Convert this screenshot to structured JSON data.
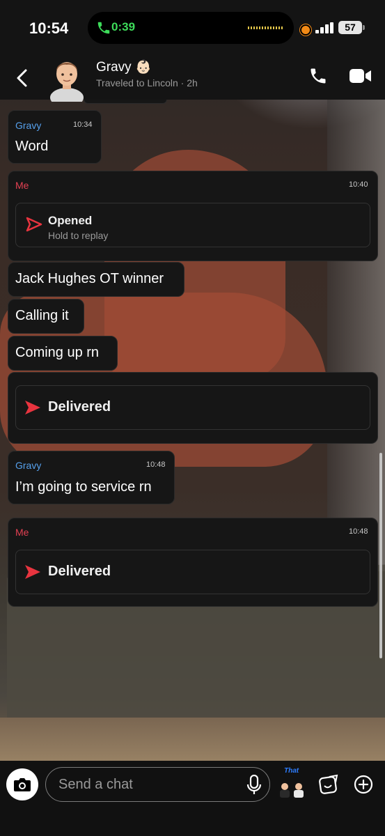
{
  "status_bar": {
    "time": "10:54",
    "call_timer": "0:39",
    "battery": "57"
  },
  "header": {
    "name": "Gravy",
    "emoji": "👶🏻",
    "subtitle": "Traveled to Lincoln · 2h"
  },
  "messages": [
    {
      "sender": "Gravy",
      "time": "10:34",
      "text": "Word"
    },
    {
      "sender": "Me",
      "time": "10:40",
      "snap_status": "Opened",
      "snap_sub": "Hold to replay"
    },
    {
      "text": "Jack Hughes OT winner"
    },
    {
      "text": "Calling it"
    },
    {
      "text": "Coming up rn"
    },
    {
      "snap_status": "Delivered"
    },
    {
      "sender": "Gravy",
      "time": "10:48",
      "text": "I’m going to service rn"
    },
    {
      "sender": "Me",
      "time": "10:48",
      "snap_status": "Delivered"
    }
  ],
  "compose": {
    "placeholder": "Send a chat",
    "bitmoji_label": "That"
  },
  "colors": {
    "friend": "#56a0ec",
    "me": "#e24052",
    "call_green": "#3ddc5a"
  }
}
